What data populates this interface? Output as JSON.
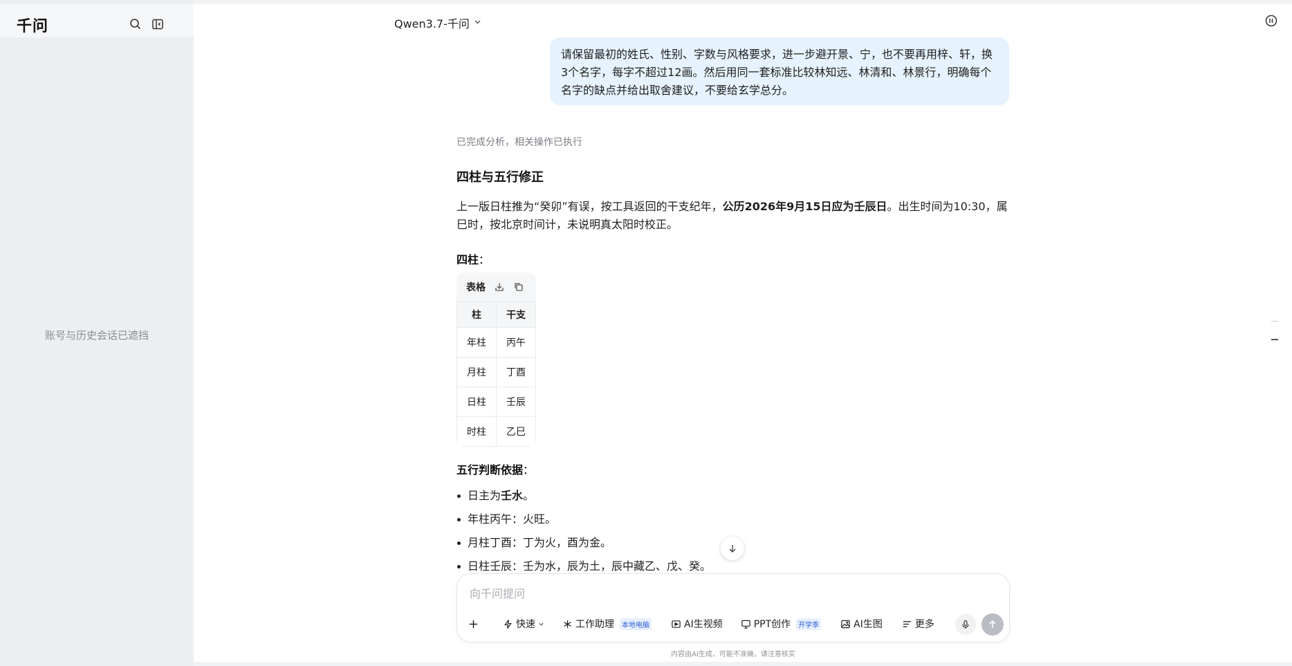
{
  "sidebar": {
    "logo": "千问",
    "masked_note": "账号与历史会话已遮挡"
  },
  "header": {
    "model_label": "Qwen3.7-千问"
  },
  "chat": {
    "user_message": "请保留最初的姓氏、性别、字数与风格要求，进一步避开景、宁，也不要再用梓、轩，换3个名字，每字不超过12画。然后用同一套标准比较林知远、林清和、林景行，明确每个名字的缺点并给出取舍建议，不要给玄学总分。",
    "status": "已完成分析，相关操作已执行",
    "section_title": "四柱与五行修正",
    "para_part1": "上一版日柱推为“癸卯”有误，按工具返回的干支纪年，",
    "para_bold": "公历2026年9月15日应为壬辰日",
    "para_part2": "。出生时间为10:30，属巳时，按北京时间计，未说明真太阳时校正。",
    "pillars_label": "四柱",
    "colon": "：",
    "table": {
      "toolbar_label": "表格",
      "headers": [
        "柱",
        "干支"
      ],
      "rows": [
        [
          "年柱",
          "丙午"
        ],
        [
          "月柱",
          "丁酉"
        ],
        [
          "日柱",
          "壬辰"
        ],
        [
          "时柱",
          "乙巳"
        ]
      ]
    },
    "wuxing_label": "五行判断依据",
    "bullets": {
      "b1_prefix": "日主为",
      "b1_bold": "壬水",
      "b1_suffix": "。",
      "b2": "年柱丙午：火旺。",
      "b3": "月柱丁酉：丁为火，酉为金。",
      "b4": "日柱壬辰：壬为水，辰为土，辰中藏乙、戊、癸。"
    }
  },
  "composer": {
    "placeholder": "向千问提问",
    "tools": {
      "speed": "快速",
      "work_assist": "工作助理",
      "work_assist_tag": "本地电脑",
      "ai_video": "AI生视频",
      "ppt": "PPT创作",
      "ppt_tag": "开学季",
      "ai_image": "AI生图",
      "more": "更多"
    }
  },
  "footer": {
    "disclaimer": "内容由AI生成，可能不准确，请注意核实"
  },
  "colors": {
    "user_bubble": "#e6f2fd",
    "tag_blue": "#2e63d6",
    "sidebar_bg": "#eceef1"
  }
}
